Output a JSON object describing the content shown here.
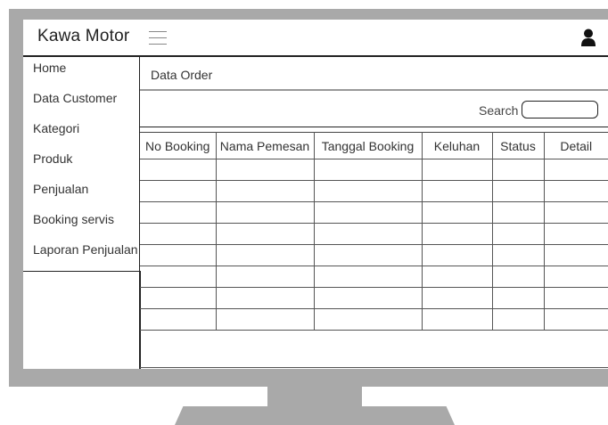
{
  "header": {
    "brand": "Kawa Motor",
    "menu_icon": "hamburger-icon",
    "user_icon": "user-icon"
  },
  "sidebar": {
    "items": [
      {
        "label": "Home"
      },
      {
        "label": "Data Customer"
      },
      {
        "label": "Kategori"
      },
      {
        "label": "Produk"
      },
      {
        "label": "Penjualan"
      },
      {
        "label": "Booking servis"
      },
      {
        "label": "Laporan Penjualan"
      }
    ]
  },
  "main": {
    "title": "Data Order",
    "search_label": "Search",
    "search_value": "",
    "table": {
      "columns": [
        "No Booking",
        "Nama Pemesan",
        "Tanggal Booking",
        "Keluhan",
        "Status",
        "Detail"
      ],
      "rows": [
        [
          "",
          "",
          "",
          "",
          "",
          ""
        ],
        [
          "",
          "",
          "",
          "",
          "",
          ""
        ],
        [
          "",
          "",
          "",
          "",
          "",
          ""
        ],
        [
          "",
          "",
          "",
          "",
          "",
          ""
        ],
        [
          "",
          "",
          "",
          "",
          "",
          ""
        ],
        [
          "",
          "",
          "",
          "",
          "",
          ""
        ],
        [
          "",
          "",
          "",
          "",
          "",
          ""
        ],
        [
          "",
          "",
          "",
          "",
          "",
          ""
        ]
      ]
    }
  },
  "colors": {
    "monitor": "#a9a9a9",
    "border": "#222222",
    "text": "#333333"
  }
}
